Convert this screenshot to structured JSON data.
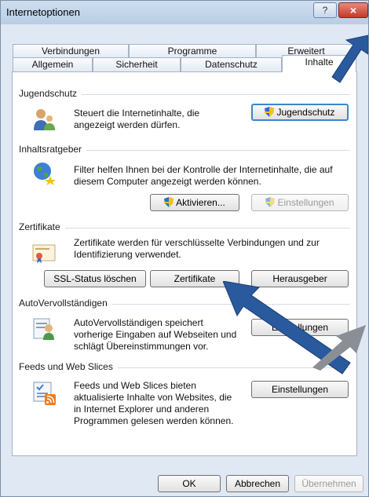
{
  "window": {
    "title": "Internetoptionen",
    "help_label": "?",
    "close_label": "×"
  },
  "tabs": {
    "row1": [
      "Verbindungen",
      "Programme",
      "Erweitert"
    ],
    "row2": [
      "Allgemein",
      "Sicherheit",
      "Datenschutz",
      "Inhalte"
    ],
    "active": "Inhalte"
  },
  "sections": {
    "jugendschutz": {
      "title": "Jugendschutz",
      "description": [
        "Steuert die Internetinhalte, die",
        "angezeigt werden dürfen."
      ],
      "button_label": "Jugendschutz"
    },
    "inhaltsratgeber": {
      "title": "Inhaltsratgeber",
      "description": [
        "Filter helfen Ihnen bei der Kontrolle der Internetinhalte, die auf",
        "diesem Computer angezeigt werden können."
      ],
      "activate_label": "Aktivieren...",
      "settings_label": "Einstellungen"
    },
    "zertifikate": {
      "title": "Zertifikate",
      "description": [
        "Zertifikate werden für verschlüsselte Verbindungen und zur",
        "Identifizierung verwendet."
      ],
      "ssl_label": "SSL-Status löschen",
      "certificates_label": "Zertifikate",
      "publisher_label": "Herausgeber"
    },
    "autovervollstaendigen": {
      "title": "AutoVervollständigen",
      "description": [
        "AutoVervollständigen speichert",
        "vorherige Eingaben auf Webseiten und",
        "schlägt Übereinstimmungen vor."
      ],
      "settings_label": "Einstellungen"
    },
    "feeds": {
      "title": "Feeds und Web Slices",
      "description": [
        "Feeds und Web Slices bieten",
        "aktualisierte Inhalte von Websites, die",
        "in Internet Explorer und anderen",
        "Programmen gelesen werden können."
      ],
      "settings_label": "Einstellungen"
    }
  },
  "footer": {
    "ok_label": "OK",
    "cancel_label": "Abbrechen",
    "apply_label": "Übernehmen"
  },
  "colors": {
    "arrow": "#2a5a9e",
    "shield_blue": "#2f6fc4",
    "shield_yellow": "#f2c21b"
  }
}
